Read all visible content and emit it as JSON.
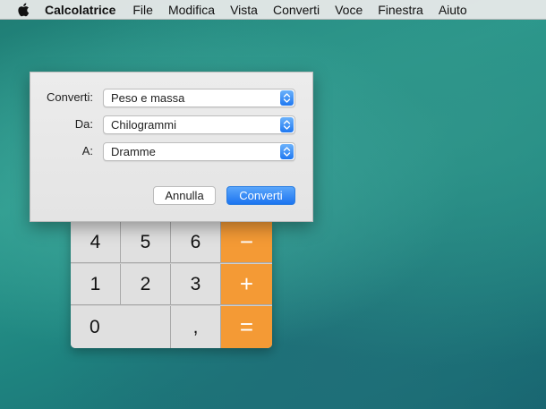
{
  "menubar": {
    "apple_icon": "apple-icon",
    "app_name": "Calcolatrice",
    "items": [
      "File",
      "Modifica",
      "Vista",
      "Converti",
      "Voce",
      "Finestra",
      "Aiuto"
    ]
  },
  "dialog": {
    "rows": [
      {
        "label": "Converti:",
        "value": "Peso e massa"
      },
      {
        "label": "Da:",
        "value": "Chilogrammi"
      },
      {
        "label": "A:",
        "value": "Dramme"
      }
    ],
    "cancel_label": "Annulla",
    "ok_label": "Converti",
    "accent": "#1f78f1"
  },
  "calculator": {
    "keys": {
      "four": "4",
      "five": "5",
      "six": "6",
      "minus": "−",
      "one": "1",
      "two": "2",
      "three": "3",
      "plus": "+",
      "zero": "0",
      "comma": ",",
      "equals": "="
    },
    "operator_color": "#f49a35"
  }
}
